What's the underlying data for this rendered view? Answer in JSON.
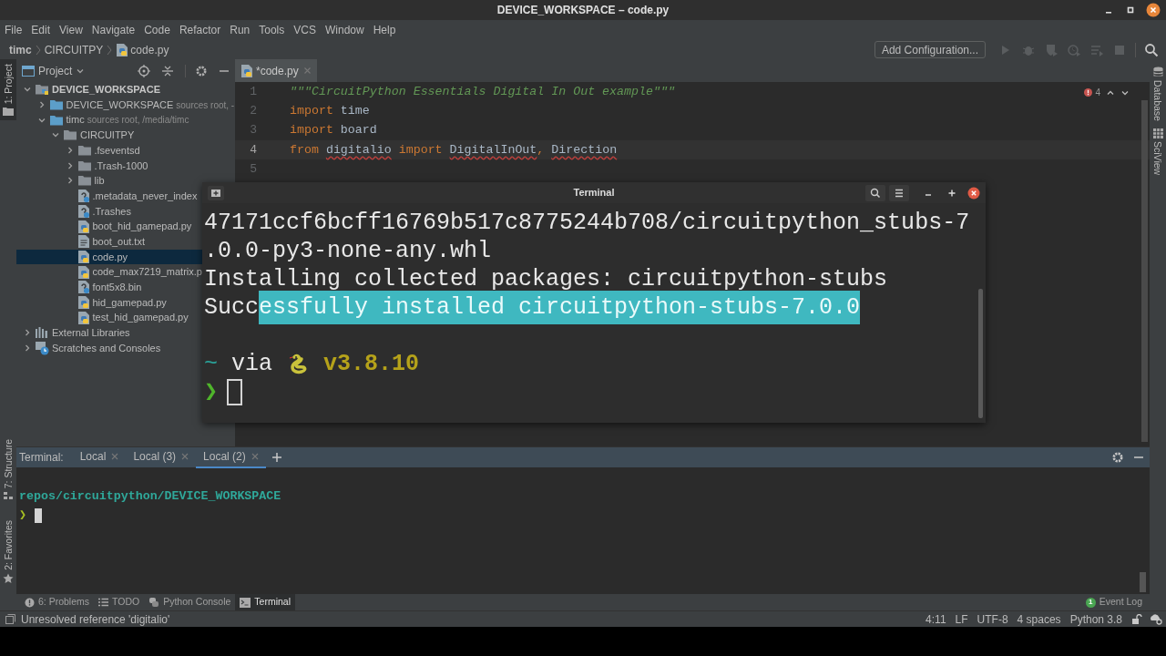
{
  "window": {
    "title": "DEVICE_WORKSPACE – code.py"
  },
  "menu": [
    "File",
    "Edit",
    "View",
    "Navigate",
    "Code",
    "Refactor",
    "Run",
    "Tools",
    "VCS",
    "Window",
    "Help"
  ],
  "breadcrumbs": [
    {
      "label": "timc",
      "kind": "root"
    },
    {
      "label": "CIRCUITPY",
      "kind": "folder"
    },
    {
      "label": "code.py",
      "kind": "python"
    }
  ],
  "toolbar": {
    "run_config": "Add Configuration..."
  },
  "left_strip": {
    "top": [
      {
        "label": "1: Project",
        "kind": "project",
        "selected": true
      }
    ],
    "bottom": [
      {
        "label": "7: Structure",
        "kind": "structure",
        "selected": false
      },
      {
        "label": "2: Favorites",
        "kind": "favorites",
        "selected": false
      }
    ]
  },
  "right_strip": [
    {
      "label": "Database",
      "kind": "database"
    },
    {
      "label": "SciView",
      "kind": "sciview"
    }
  ],
  "project_panel": {
    "title": "Project",
    "tree": [
      {
        "label": "DEVICE_WORKSPACE",
        "kind": "module",
        "expanded": true,
        "selected": false,
        "children": [
          {
            "label": "DEVICE_WORKSPACE",
            "hint": "sources root, -",
            "kind": "folder",
            "expanded": false,
            "selected": false
          },
          {
            "label": "timc",
            "hint": "sources root,  /media/timc",
            "kind": "folder",
            "expanded": true,
            "selected": false,
            "children": [
              {
                "label": "CIRCUITPY",
                "kind": "folder_plain",
                "expanded": true,
                "selected": false,
                "children": [
                  {
                    "label": ".fseventsd",
                    "kind": "folder_plain",
                    "expanded": false,
                    "selected": false
                  },
                  {
                    "label": ".Trash-1000",
                    "kind": "folder_plain",
                    "expanded": false,
                    "selected": false
                  },
                  {
                    "label": "lib",
                    "kind": "folder_plain",
                    "expanded": false,
                    "selected": false
                  },
                  {
                    "label": ".metadata_never_index",
                    "kind": "unknown",
                    "selected": false
                  },
                  {
                    "label": ".Trashes",
                    "kind": "unknown",
                    "selected": false
                  },
                  {
                    "label": "boot_hid_gamepad.py",
                    "kind": "python",
                    "selected": false
                  },
                  {
                    "label": "boot_out.txt",
                    "kind": "text",
                    "selected": false
                  },
                  {
                    "label": "code.py",
                    "kind": "python",
                    "selected": true
                  },
                  {
                    "label": "code_max7219_matrix.p",
                    "kind": "python",
                    "selected": false
                  },
                  {
                    "label": "font5x8.bin",
                    "kind": "unknown",
                    "selected": false
                  },
                  {
                    "label": "hid_gamepad.py",
                    "kind": "python",
                    "selected": false
                  },
                  {
                    "label": "test_hid_gamepad.py",
                    "kind": "python",
                    "selected": false
                  }
                ]
              }
            ]
          }
        ]
      },
      {
        "label": "External Libraries",
        "kind": "libraries",
        "expanded": false,
        "selected": false
      },
      {
        "label": "Scratches and Consoles",
        "kind": "scratches",
        "expanded": false,
        "selected": false
      }
    ]
  },
  "editor": {
    "tabs": [
      {
        "label": "*code.py",
        "selected": true
      }
    ],
    "error_count": "4",
    "lines": [
      {
        "number": "1",
        "current": false,
        "tokens": [
          {
            "text": "\"\"\"CircuitPython Essentials Digital In Out example\"\"\"",
            "kind": "string"
          }
        ]
      },
      {
        "number": "2",
        "current": false,
        "tokens": [
          {
            "text": "import",
            "kind": "keyword"
          },
          {
            "text": " time",
            "kind": "plain"
          }
        ]
      },
      {
        "number": "3",
        "current": false,
        "tokens": [
          {
            "text": "import",
            "kind": "keyword"
          },
          {
            "text": " board",
            "kind": "plain"
          }
        ]
      },
      {
        "number": "4",
        "current": true,
        "tokens": [
          {
            "text": "from ",
            "kind": "keyword"
          },
          {
            "text": "digitalio",
            "kind": "plain",
            "error": true
          },
          {
            "text": " import ",
            "kind": "keyword"
          },
          {
            "text": "DigitalInOut",
            "kind": "plain",
            "error": true
          },
          {
            "text": ", ",
            "kind": "punct"
          },
          {
            "text": "Direction",
            "kind": "plain",
            "error": true
          }
        ]
      },
      {
        "number": "5",
        "current": false
      }
    ]
  },
  "floating_terminal": {
    "title": "Terminal",
    "lines": [
      {
        "segments": [
          {
            "text": "47171ccf6bcff16769b517c8775244b708/circuitpython_stubs-7",
            "kind": "plain"
          }
        ]
      },
      {
        "segments": [
          {
            "text": ".0.0-py3-none-any.whl",
            "kind": "plain"
          }
        ]
      },
      {
        "segments": [
          {
            "text": "Installing collected packages: circuitpython-stubs",
            "kind": "plain"
          }
        ]
      },
      {
        "segments": [
          {
            "text": "Succ",
            "kind": "plain"
          },
          {
            "text": "essfully installed circuitpython-stubs-7.0.0",
            "kind": "selected"
          }
        ]
      },
      {
        "kind": "blank"
      },
      {
        "segments": [
          {
            "text": "~",
            "kind": "tilde"
          },
          {
            "text": " via ",
            "kind": "plain"
          },
          {
            "kind": "snake"
          },
          {
            "text": " v3.8.10",
            "kind": "version"
          }
        ]
      },
      {
        "segments": [
          {
            "text": "❯",
            "kind": "prompt"
          },
          {
            "kind": "cursor",
            "filled": false
          }
        ]
      }
    ]
  },
  "terminal_panel": {
    "label": "Terminal:",
    "tabs": [
      {
        "label": "Local",
        "selected": false
      },
      {
        "label": "Local (3)",
        "selected": false
      },
      {
        "label": "Local (2)",
        "selected": true
      }
    ],
    "lines": [
      {
        "kind": "blank"
      },
      {
        "segments": [
          {
            "text": "repos/circuitpython/DEVICE_WORKSPACE",
            "kind": "path"
          }
        ]
      },
      {
        "segments": [
          {
            "text": "❯",
            "kind": "prompt_small"
          },
          {
            "kind": "cursor",
            "filled": true
          }
        ]
      }
    ]
  },
  "tool_tabs": [
    {
      "label": "6: Problems",
      "kind": "problems",
      "selected": false
    },
    {
      "label": "TODO",
      "kind": "todo",
      "selected": false
    },
    {
      "label": "Python Console",
      "kind": "python",
      "selected": false
    },
    {
      "label": "Terminal",
      "kind": "terminal",
      "selected": true
    }
  ],
  "event_log": {
    "label": "Event Log",
    "count": "1"
  },
  "status_bar": {
    "message": "Unresolved reference 'digitalio'",
    "items": [
      "4:11",
      "LF",
      "UTF-8",
      "4 spaces",
      "Python 3.8"
    ]
  }
}
